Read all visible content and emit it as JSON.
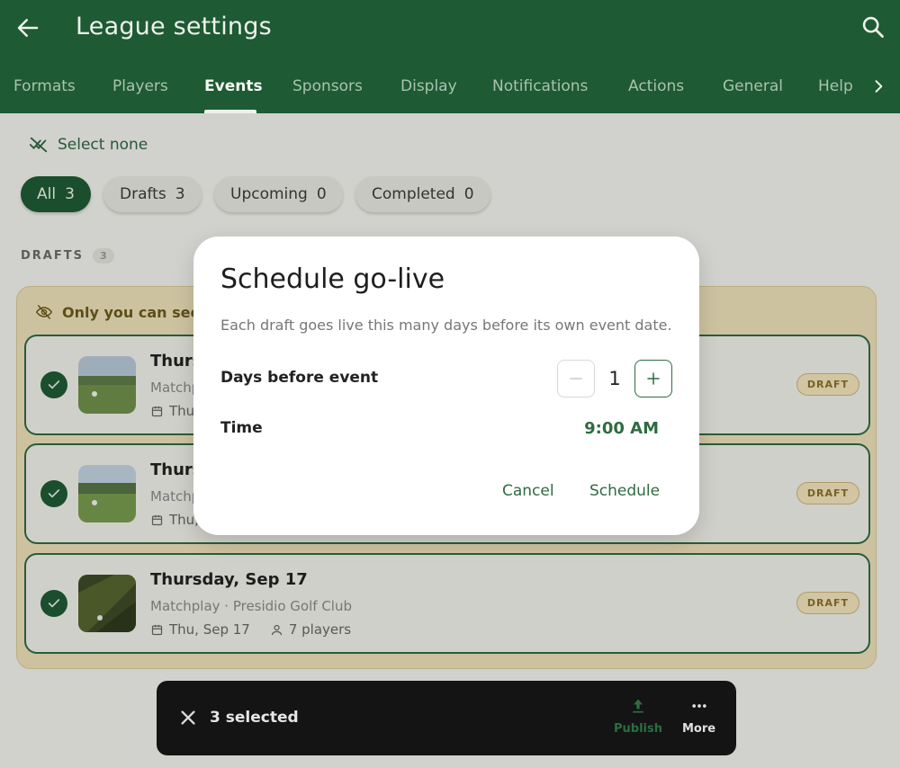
{
  "appbar": {
    "title": "League settings"
  },
  "tabs": [
    {
      "label": "Formats"
    },
    {
      "label": "Players"
    },
    {
      "label": "Events"
    },
    {
      "label": "Sponsors"
    },
    {
      "label": "Display"
    },
    {
      "label": "Notifications"
    },
    {
      "label": "Actions"
    },
    {
      "label": "General"
    },
    {
      "label": "Help"
    }
  ],
  "active_tab": "Events",
  "select_none_label": "Select none",
  "filters": [
    {
      "label": "All",
      "count": "3"
    },
    {
      "label": "Drafts",
      "count": "3"
    },
    {
      "label": "Upcoming",
      "count": "0"
    },
    {
      "label": "Completed",
      "count": "0"
    }
  ],
  "section": {
    "label": "DRAFTS",
    "count": "3"
  },
  "notice": "Only you can see t",
  "events": [
    {
      "name": "Thurs",
      "sub": "Matchp",
      "date": "Thu",
      "players": "",
      "badge": "DRAFT"
    },
    {
      "name": "Thurs",
      "sub": "Matchp",
      "date": "Thu,",
      "players": "",
      "badge": "DRAFT"
    },
    {
      "name": "Thursday, Sep 17",
      "sub": "Matchplay · Presidio Golf Club",
      "date": "Thu, Sep 17",
      "players": "7 players",
      "badge": "DRAFT"
    }
  ],
  "bottom_bar": {
    "selected": "3 selected",
    "publish": "Publish",
    "more": "More"
  },
  "dialog": {
    "title": "Schedule go-live",
    "description": "Each draft goes live this many days before its own event date.",
    "days_label": "Days before event",
    "days_value": "1",
    "time_label": "Time",
    "time_value": "9:00 AM",
    "cancel": "Cancel",
    "confirm": "Schedule"
  },
  "colors": {
    "brand": "#1e5a33",
    "accent": "#2f6b42",
    "draft_bg": "#ecdfb8"
  }
}
